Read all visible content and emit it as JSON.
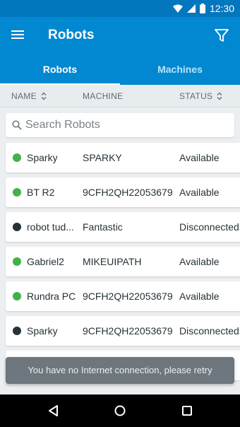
{
  "status_bar": {
    "time": "12:30"
  },
  "app_bar": {
    "title": "Robots"
  },
  "tabs": [
    {
      "label": "Robots",
      "active": true
    },
    {
      "label": "Machines",
      "active": false
    }
  ],
  "columns": {
    "name": "NAME",
    "machine": "MACHINE",
    "status": "STATUS"
  },
  "search": {
    "placeholder": "Search Robots",
    "value": ""
  },
  "robots": [
    {
      "name": "Sparky",
      "machine": "SPARKY",
      "status": "Available",
      "state": "available"
    },
    {
      "name": "BT R2",
      "machine": "9CFH2QH22053679",
      "status": "Available",
      "state": "available"
    },
    {
      "name": "robot tud...",
      "machine": "Fantastic",
      "status": "Disconnected",
      "state": "disconnected"
    },
    {
      "name": "Gabriel2",
      "machine": "MIKEUIPATH",
      "status": "Available",
      "state": "available"
    },
    {
      "name": "Rundra PC",
      "machine": "9CFH2QH22053679",
      "status": "Available",
      "state": "available"
    },
    {
      "name": "Sparky",
      "machine": "9CFH2QH22053679",
      "status": "Disconnected",
      "state": "disconnected"
    }
  ],
  "snackbar": {
    "message": "You have no Internet connection, please retry"
  },
  "colors": {
    "primary": "#0288d1",
    "status_bar": "#0277bd",
    "available": "#43b049",
    "disconnected": "#263238"
  }
}
